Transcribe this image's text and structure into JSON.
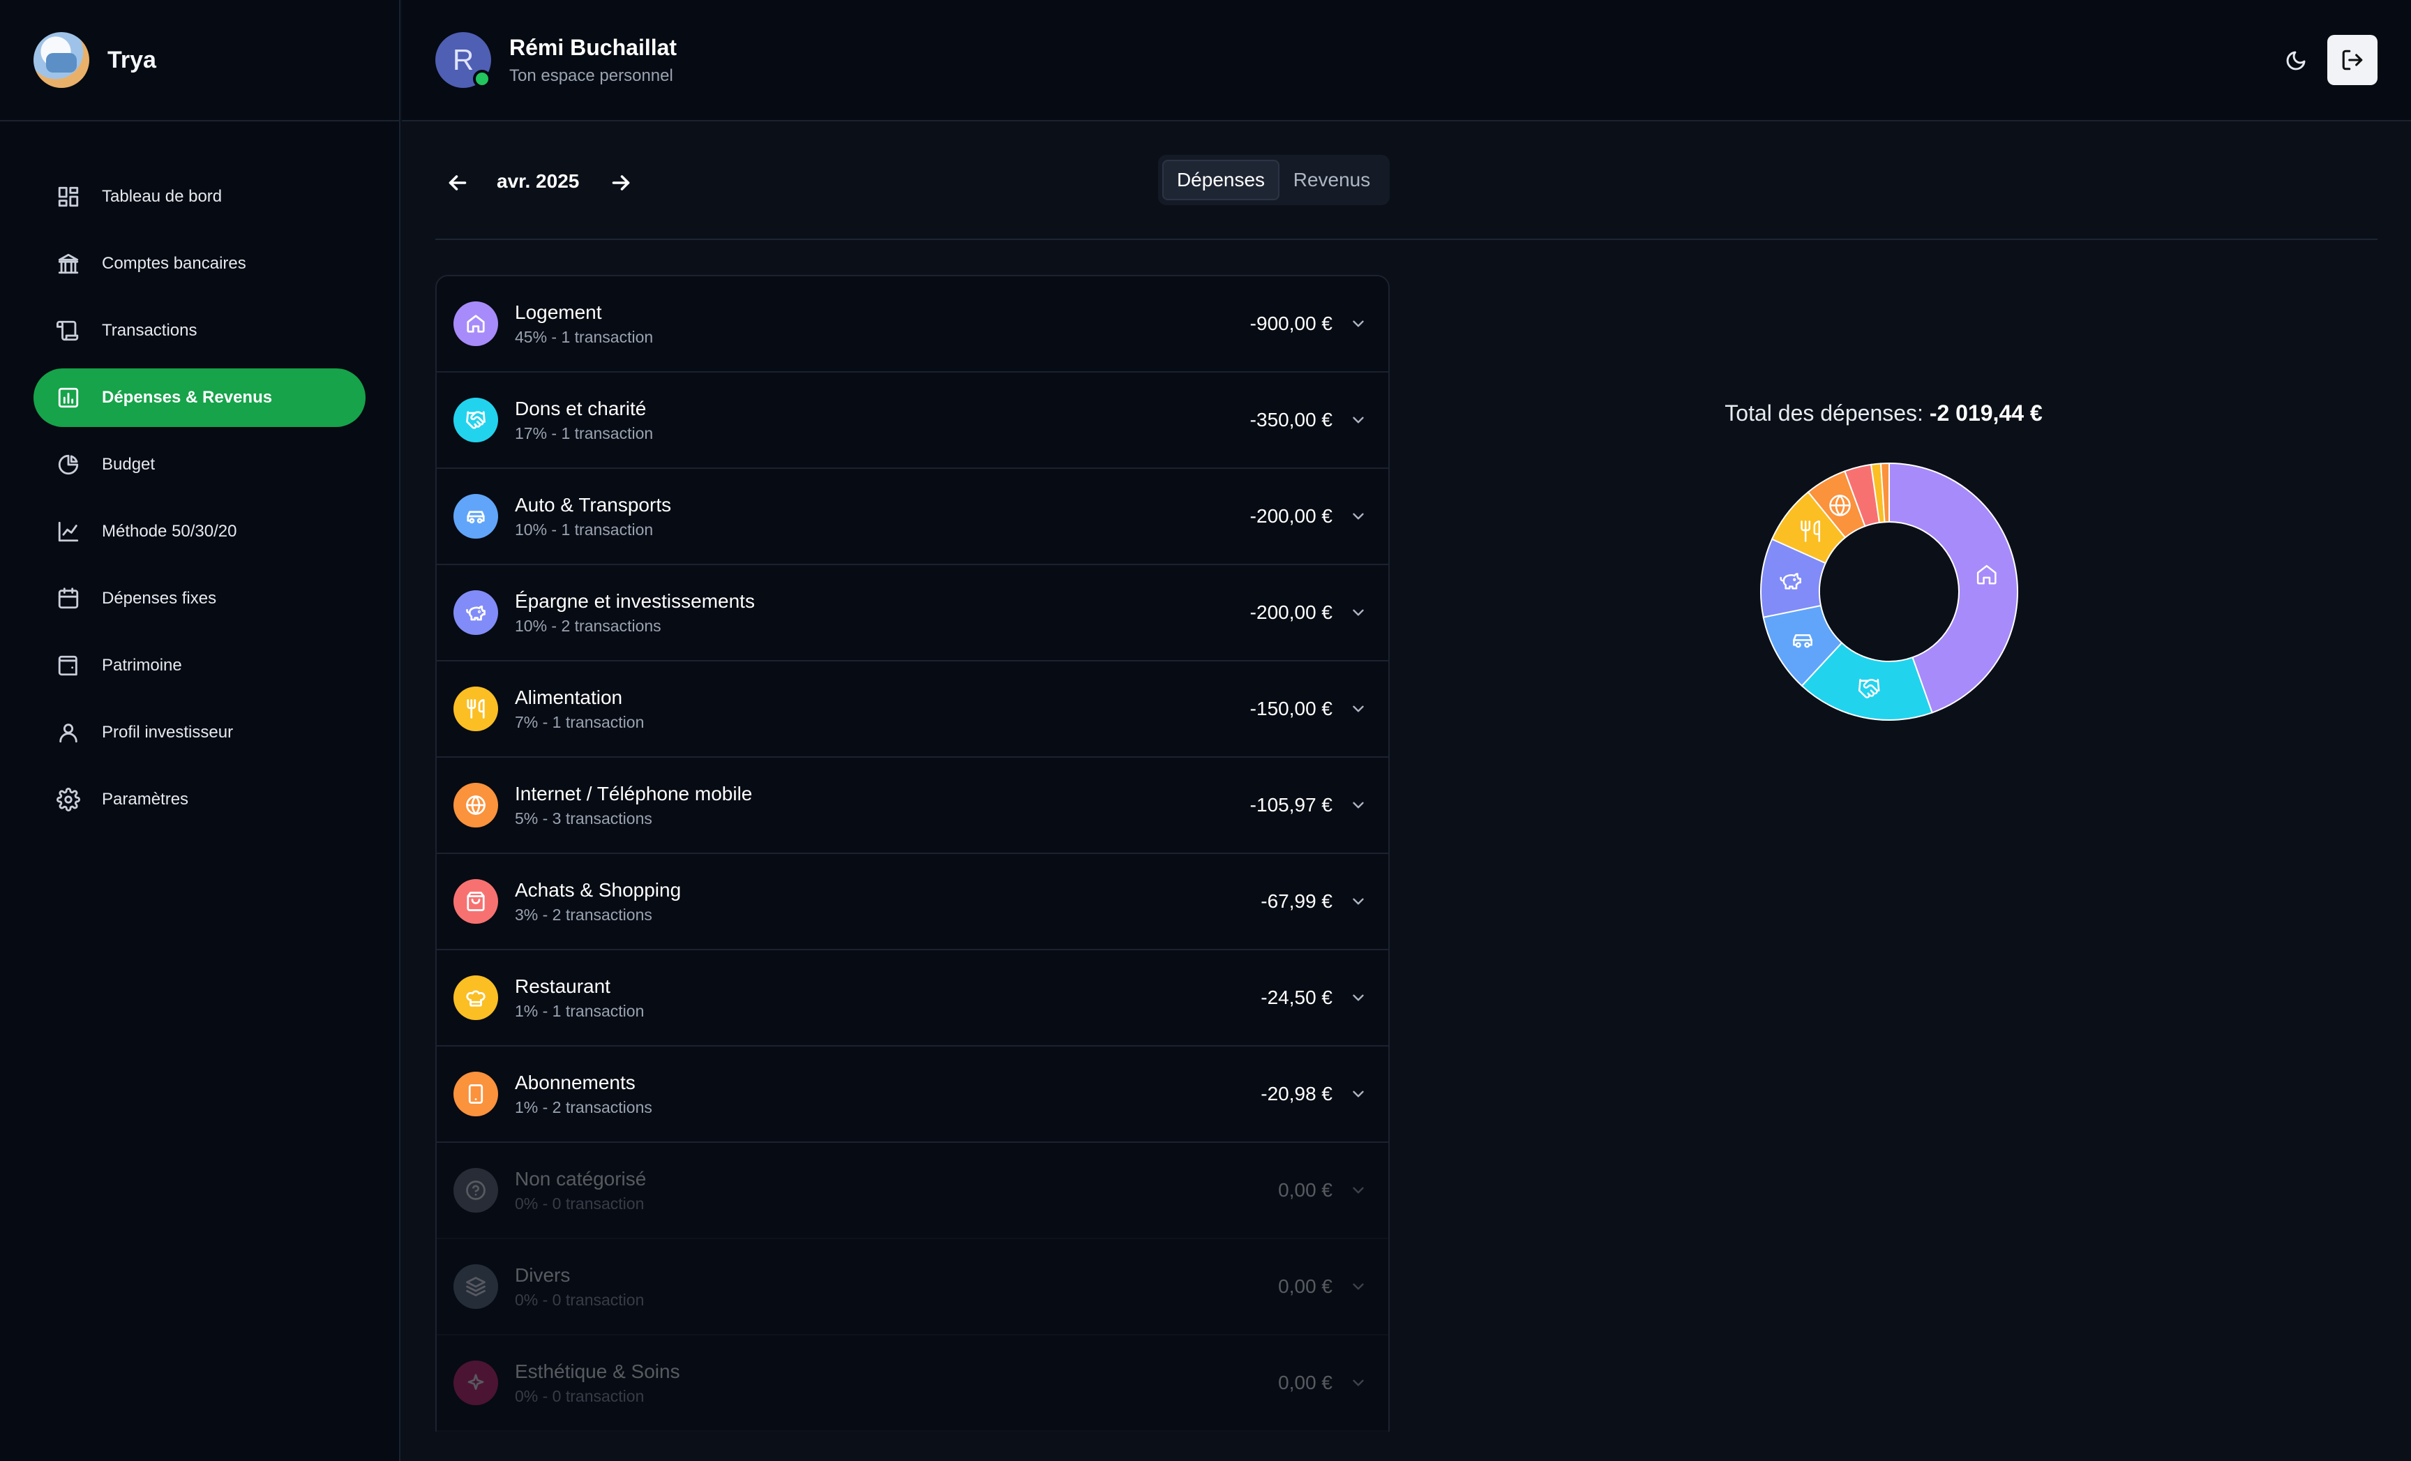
{
  "app": {
    "name": "Trya"
  },
  "sidebar": {
    "items": [
      {
        "label": "Tableau de bord",
        "icon": "dashboard-icon",
        "active": false
      },
      {
        "label": "Comptes bancaires",
        "icon": "bank-icon",
        "active": false
      },
      {
        "label": "Transactions",
        "icon": "scroll-icon",
        "active": false
      },
      {
        "label": "Dépenses & Revenus",
        "icon": "bar-chart-icon",
        "active": true
      },
      {
        "label": "Budget",
        "icon": "pie-chart-icon",
        "active": false
      },
      {
        "label": "Méthode 50/30/20",
        "icon": "line-chart-icon",
        "active": false
      },
      {
        "label": "Dépenses fixes",
        "icon": "calendar-icon",
        "active": false
      },
      {
        "label": "Patrimoine",
        "icon": "wallet-icon",
        "active": false
      },
      {
        "label": "Profil investisseur",
        "icon": "user-icon",
        "active": false
      },
      {
        "label": "Paramètres",
        "icon": "gear-icon",
        "active": false
      }
    ]
  },
  "header": {
    "avatar_initial": "R",
    "user_name": "Rémi Buchaillat",
    "user_subtitle": "Ton espace personnel"
  },
  "toolbar": {
    "month": "avr. 2025",
    "toggle": {
      "expenses": "Dépenses",
      "income": "Revenus",
      "selected": "expenses"
    }
  },
  "colors": {
    "accent": "#16a34a",
    "online": "#22c55e"
  },
  "categories": [
    {
      "name": "Logement",
      "meta": "45% - 1 transaction",
      "amount": "-900,00 €",
      "color": "#a78bfa",
      "icon": "home-icon",
      "muted": false
    },
    {
      "name": "Dons et charité",
      "meta": "17% - 1 transaction",
      "amount": "-350,00 €",
      "color": "#22d3ee",
      "icon": "handshake-icon",
      "muted": false
    },
    {
      "name": "Auto & Transports",
      "meta": "10% - 1 transaction",
      "amount": "-200,00 €",
      "color": "#60a5fa",
      "icon": "car-icon",
      "muted": false
    },
    {
      "name": "Épargne et investissements",
      "meta": "10% - 2 transactions",
      "amount": "-200,00 €",
      "color": "#818cf8",
      "icon": "piggy-bank-icon",
      "muted": false
    },
    {
      "name": "Alimentation",
      "meta": "7% - 1 transaction",
      "amount": "-150,00 €",
      "color": "#fbbf24",
      "icon": "utensils-icon",
      "muted": false
    },
    {
      "name": "Internet / Téléphone mobile",
      "meta": "5% - 3 transactions",
      "amount": "-105,97 €",
      "color": "#fb923c",
      "icon": "globe-icon",
      "muted": false
    },
    {
      "name": "Achats & Shopping",
      "meta": "3% - 2 transactions",
      "amount": "-67,99 €",
      "color": "#f87171",
      "icon": "shopping-bag-icon",
      "muted": false
    },
    {
      "name": "Restaurant",
      "meta": "1% - 1 transaction",
      "amount": "-24,50 €",
      "color": "#fbbf24",
      "icon": "chef-hat-icon",
      "muted": false
    },
    {
      "name": "Abonnements",
      "meta": "1% - 2 transactions",
      "amount": "-20,98 €",
      "color": "#fb923c",
      "icon": "smartphone-icon",
      "muted": false
    },
    {
      "name": "Non catégorisé",
      "meta": "0% - 0 transaction",
      "amount": "0,00 €",
      "color": "#6b7280",
      "icon": "help-circle-icon",
      "muted": true
    },
    {
      "name": "Divers",
      "meta": "0% - 0 transaction",
      "amount": "0,00 €",
      "color": "#64748b",
      "icon": "layers-icon",
      "muted": true
    },
    {
      "name": "Esthétique & Soins",
      "meta": "0% - 0 transaction",
      "amount": "0,00 €",
      "color": "#db2777",
      "icon": "sparkles-icon",
      "muted": true
    }
  ],
  "summary": {
    "label": "Total des dépenses:",
    "value": "-2 019,44 €"
  },
  "chart_data": {
    "type": "pie",
    "donut": true,
    "categories": [
      "Logement",
      "Dons et charité",
      "Auto & Transports",
      "Épargne et investissements",
      "Alimentation",
      "Internet / Téléphone mobile",
      "Achats & Shopping",
      "Restaurant",
      "Abonnements"
    ],
    "values": [
      900,
      350,
      200,
      200,
      150,
      105.97,
      67.99,
      24.5,
      20.98
    ],
    "colors": [
      "#a78bfa",
      "#22d3ee",
      "#60a5fa",
      "#818cf8",
      "#fbbf24",
      "#fb923c",
      "#f87171",
      "#fbbf24",
      "#fb923c"
    ],
    "icons": [
      "home-icon",
      "handshake-icon",
      "car-icon",
      "piggy-bank-icon",
      "utensils-icon",
      "globe-icon",
      null,
      null,
      null
    ]
  }
}
